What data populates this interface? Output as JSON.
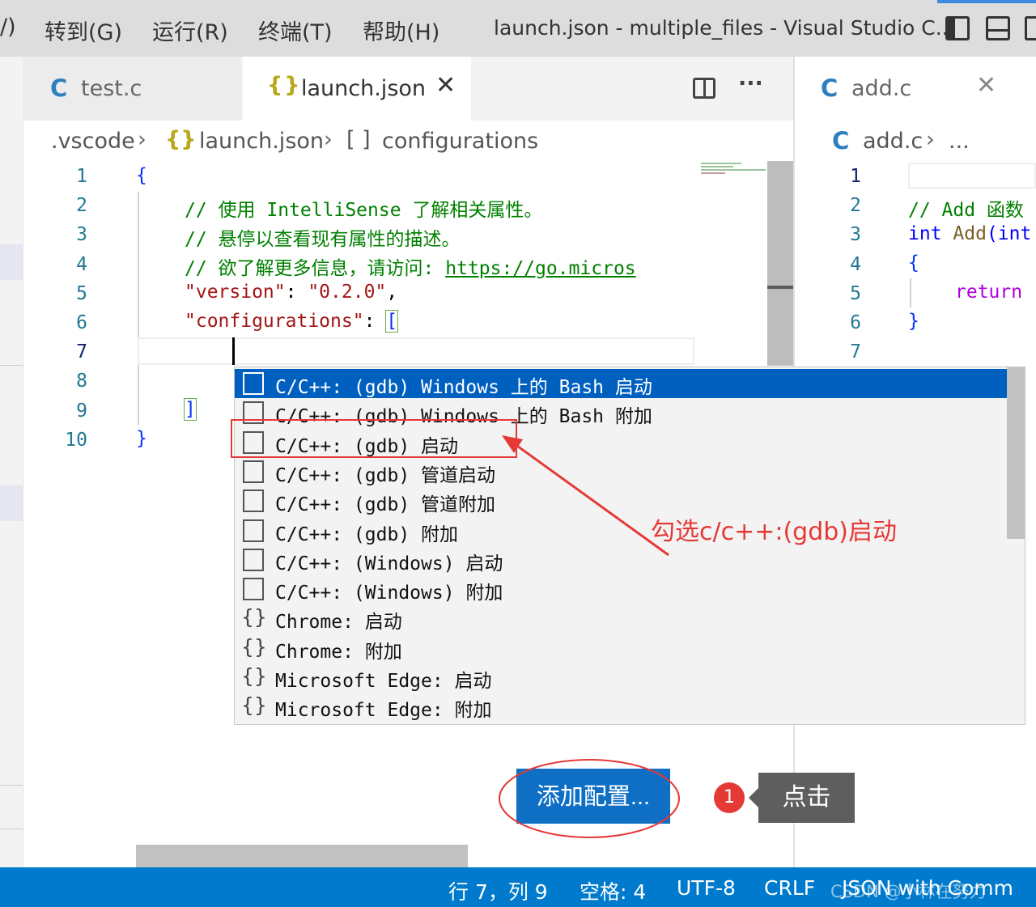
{
  "menu": {
    "partial": "/)",
    "goto": "转到(G)",
    "run": "运行(R)",
    "terminal": "终端(T)",
    "help": "帮助(H)"
  },
  "window_title": "launch.json - multiple_files - Visual Studio C...",
  "tabs": [
    {
      "icon": "C",
      "label": "test.c"
    },
    {
      "icon": "{}",
      "label": "launch.json",
      "close": "✕"
    }
  ],
  "right_tab": {
    "icon": "C",
    "label": "add.c",
    "close": "✕"
  },
  "tab_actions": {
    "split": "split-editor-icon",
    "more": "···"
  },
  "breadcrumb": {
    "folder": ".vscode",
    "file_icon": "{}",
    "file": "launch.json",
    "symbol_icon": "[ ]",
    "symbol": "configurations"
  },
  "right_breadcrumb": {
    "icon": "C",
    "file": "add.c",
    "more": "..."
  },
  "editor": {
    "line_numbers": [
      "1",
      "2",
      "3",
      "4",
      "5",
      "6",
      "7",
      "8",
      "9",
      "10"
    ],
    "lines": {
      "l1": "{",
      "l2": "// 使用 IntelliSense 了解相关属性。",
      "l3": "// 悬停以查看现有属性的描述。",
      "l4_comment": "// 欲了解更多信息，请访问: ",
      "l4_link": "https://go.micros",
      "l5_key": "\"version\"",
      "l5_colon": ": ",
      "l5_val": "\"0.2.0\"",
      "l5_comma": ",",
      "l6_key": "\"configurations\"",
      "l6_colon": ": ",
      "l6_bracket": "[",
      "l9": "]",
      "l10": "}"
    }
  },
  "right_editor": {
    "line_numbers": [
      "1",
      "2",
      "3",
      "4",
      "5",
      "6",
      "7"
    ],
    "l2": "// Add 函数",
    "l3_kw": "int",
    "l3_fn": "Add",
    "l3_rest": "(int",
    "l4": "{",
    "l5": "return",
    "l6": "}"
  },
  "suggestions": [
    {
      "icon": "box",
      "label": "C/C++: (gdb) Windows 上的 Bash 启动",
      "selected": true
    },
    {
      "icon": "box",
      "label": "C/C++: (gdb) Windows 上的 Bash 附加"
    },
    {
      "icon": "box",
      "label": "C/C++: (gdb) 启动"
    },
    {
      "icon": "box",
      "label": "C/C++: (gdb) 管道启动"
    },
    {
      "icon": "box",
      "label": "C/C++: (gdb) 管道附加"
    },
    {
      "icon": "box",
      "label": "C/C++: (gdb) 附加"
    },
    {
      "icon": "box",
      "label": "C/C++: (Windows) 启动"
    },
    {
      "icon": "box",
      "label": "C/C++: (Windows) 附加"
    },
    {
      "icon": "{}",
      "label": "Chrome: 启动"
    },
    {
      "icon": "{}",
      "label": "Chrome: 附加"
    },
    {
      "icon": "{}",
      "label": "Microsoft Edge: 启动"
    },
    {
      "icon": "{}",
      "label": "Microsoft Edge: 附加"
    }
  ],
  "add_config_button": "添加配置...",
  "annotations": {
    "check_text": "勾选c/c++:(gdb)启动",
    "step_number": "1",
    "click_text": "点击",
    "color": "#e53935"
  },
  "statusbar": {
    "position": "行 7，列 9",
    "spaces": "空格: 4",
    "encoding": "UTF-8",
    "eol": "CRLF",
    "language": "JSON with Comm",
    "watermark": "CSDN @小林在努力"
  },
  "colors": {
    "statusbar": "#007acc",
    "selection": "#0060c0",
    "button": "#0e6fc5"
  }
}
